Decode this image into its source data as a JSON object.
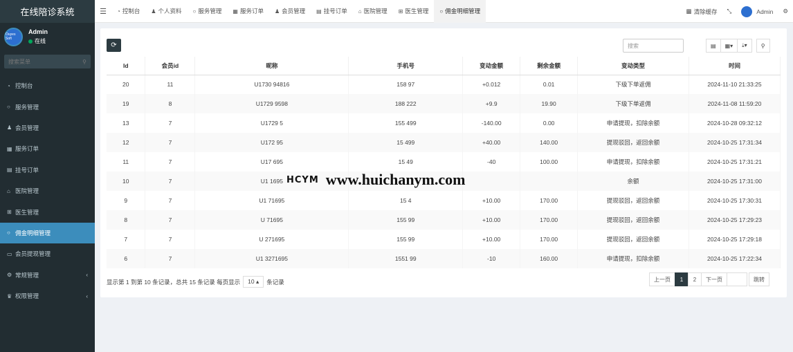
{
  "app": {
    "title": "在线陪诊系统"
  },
  "user": {
    "avatar_text": "Ouyes Soft",
    "name": "Admin",
    "status": "在线"
  },
  "sidebar": {
    "search_placeholder": "搜索菜单",
    "items": [
      {
        "label": "控制台",
        "icon": "dashboard-icon"
      },
      {
        "label": "服务管理",
        "icon": "circle-icon"
      },
      {
        "label": "会员管理",
        "icon": "user-icon"
      },
      {
        "label": "服务订单",
        "icon": "calendar-icon"
      },
      {
        "label": "挂号订单",
        "icon": "list-icon"
      },
      {
        "label": "医院管理",
        "icon": "bank-icon"
      },
      {
        "label": "医生管理",
        "icon": "plus-square-icon"
      },
      {
        "label": "佣金明细管理",
        "icon": "circle-icon",
        "active": true
      },
      {
        "label": "会员提现管理",
        "icon": "card-icon"
      },
      {
        "label": "常规管理",
        "icon": "cogs-icon",
        "has_children": true
      },
      {
        "label": "权限管理",
        "icon": "users-icon",
        "has_children": true
      }
    ]
  },
  "topnav": {
    "tabs": [
      {
        "label": "控制台",
        "icon": "dashboard-icon"
      },
      {
        "label": "个人资料",
        "icon": "user-icon"
      },
      {
        "label": "服务管理",
        "icon": "circle-icon"
      },
      {
        "label": "服务订单",
        "icon": "calendar-icon"
      },
      {
        "label": "会员管理",
        "icon": "user-icon"
      },
      {
        "label": "挂号订单",
        "icon": "list-icon"
      },
      {
        "label": "医院管理",
        "icon": "bank-icon"
      },
      {
        "label": "医生管理",
        "icon": "plus-square-icon"
      },
      {
        "label": "佣金明细管理",
        "icon": "circle-icon",
        "active": true
      }
    ],
    "clear_cache": "清除缓存",
    "admin_name": "Admin"
  },
  "toolbar": {
    "search_placeholder": "搜索"
  },
  "table": {
    "columns": [
      "Id",
      "会员id",
      "昵称",
      "手机号",
      "变动金额",
      "剩余金额",
      "变动类型",
      "时间"
    ],
    "rows": [
      [
        "20",
        "11",
        "U1730    94816",
        "158    97",
        "+0.012",
        "0.01",
        "下级下单返佣",
        "2024-11-10 21:33:25"
      ],
      [
        "19",
        "8",
        "U1729    9598",
        "188    222",
        "+9.9",
        "19.90",
        "下级下单返佣",
        "2024-11-08 11:59:20"
      ],
      [
        "13",
        "7",
        "U1729    5",
        "155    499",
        "-140.00",
        "0.00",
        "申请提现，扣除余额",
        "2024-10-28 09:32:12"
      ],
      [
        "12",
        "7",
        "U172    95",
        "15    499",
        "+40.00",
        "140.00",
        "提现驳回，返回余额",
        "2024-10-25 17:31:34"
      ],
      [
        "11",
        "7",
        "U17    695",
        "15    49",
        "-40",
        "100.00",
        "申请提现，扣除余额",
        "2024-10-25 17:31:21"
      ],
      [
        "10",
        "7",
        "U1    1695",
        "",
        "",
        "",
        "余额",
        "2024-10-25 17:31:00"
      ],
      [
        "9",
        "7",
        "U1    71695",
        "15    4",
        "+10.00",
        "170.00",
        "提现驳回，返回余额",
        "2024-10-25 17:30:31"
      ],
      [
        "8",
        "7",
        "U    71695",
        "155    99",
        "+10.00",
        "170.00",
        "提现驳回，返回余额",
        "2024-10-25 17:29:23"
      ],
      [
        "7",
        "7",
        "U    271695",
        "155    99",
        "+10.00",
        "170.00",
        "提现驳回，返回余额",
        "2024-10-25 17:29:18"
      ],
      [
        "6",
        "7",
        "U1    3271695",
        "1551    99",
        "-10",
        "160.00",
        "申请提现，扣除余额",
        "2024-10-25 17:22:34"
      ]
    ]
  },
  "footer": {
    "info_prefix": "显示第 1 到第 10 条记录，总共 15 条记录 每页显示",
    "page_size": "10",
    "info_suffix": "条记录",
    "pager": {
      "prev": "上一页",
      "pages": [
        "1",
        "2"
      ],
      "next": "下一页",
      "jump": "跳转"
    }
  },
  "watermark": {
    "logo": "HCYM",
    "url": "www.huichanym.com"
  }
}
